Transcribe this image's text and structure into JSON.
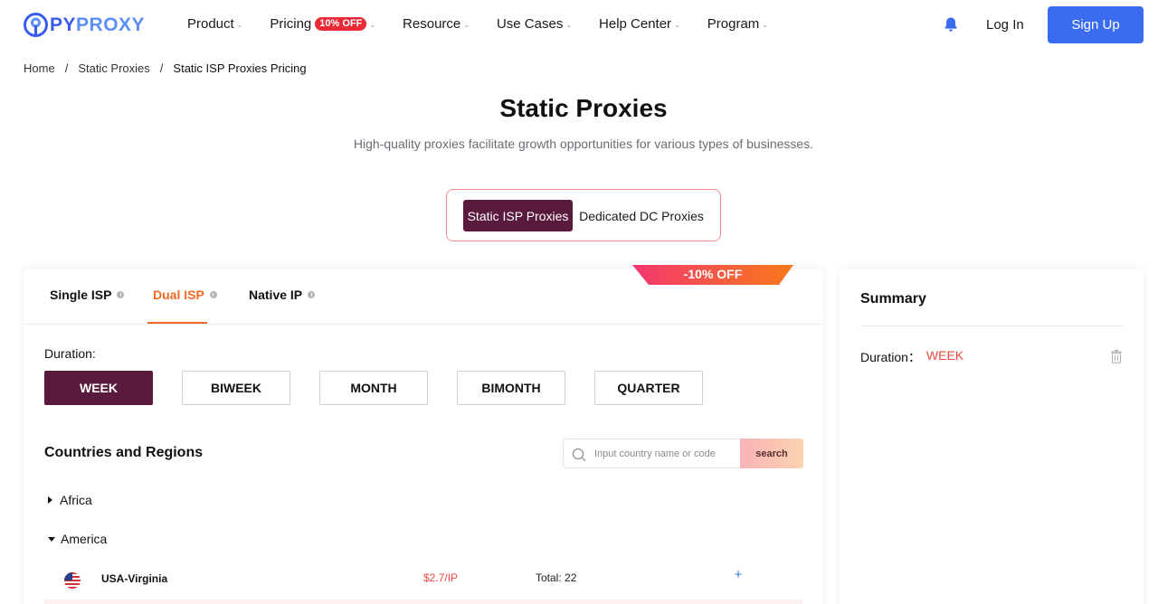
{
  "header": {
    "logo": {
      "prefix": "PY",
      "rest": "PROXY"
    },
    "nav": [
      {
        "label": "Product",
        "caret": "⌄"
      },
      {
        "label": "Pricing",
        "badge": "10% OFF",
        "caret": "⌄"
      },
      {
        "label": "Resource",
        "caret": "⌄"
      },
      {
        "label": "Use Cases",
        "caret": "⌄"
      },
      {
        "label": "Help Center",
        "caret": "⌄"
      },
      {
        "label": "Program",
        "caret": "⌄"
      }
    ],
    "notification_icon": "bell-icon",
    "login_label": "Log In",
    "signup_label": "Sign Up"
  },
  "breadcrumb": {
    "items": [
      "Home",
      "Static Proxies",
      "Static ISP Proxies Pricing"
    ],
    "separator": "/"
  },
  "hero": {
    "title": "Static Proxies",
    "subtitle": "High-quality proxies facilitate growth opportunities for various types of businesses."
  },
  "proxy_types": {
    "active": "Static ISP Proxies",
    "inactive": "Dedicated DC Proxies"
  },
  "plan": {
    "discount_ribbon": "-10% OFF",
    "tabs": [
      {
        "label": "Single ISP",
        "active": false
      },
      {
        "label": "Dual ISP",
        "active": true
      },
      {
        "label": "Native IP",
        "active": false
      }
    ],
    "duration_label": "Duration:",
    "durations": [
      "WEEK",
      "BIWEEK",
      "MONTH",
      "BIMONTH",
      "QUARTER"
    ],
    "selected_duration": "WEEK",
    "regions_title": "Countries and Regions",
    "search": {
      "placeholder": "Input country name or code",
      "button_label": "search"
    },
    "regions": [
      {
        "name": "Africa",
        "expanded": false
      },
      {
        "name": "America",
        "expanded": true
      }
    ],
    "countries": [
      {
        "name": "USA-Virginia",
        "price": "$2.7/IP",
        "total": "Total: 22",
        "add": "+"
      }
    ]
  },
  "summary": {
    "title": "Summary",
    "duration_label": "Duration：",
    "duration_value": "WEEK"
  },
  "colors": {
    "brand_blue": "#3b6cf0",
    "accent_plum": "#5a1a3e",
    "accent_orange": "#f06a26",
    "price_red": "#ea4a3f",
    "badge_red": "#ea2b35"
  }
}
